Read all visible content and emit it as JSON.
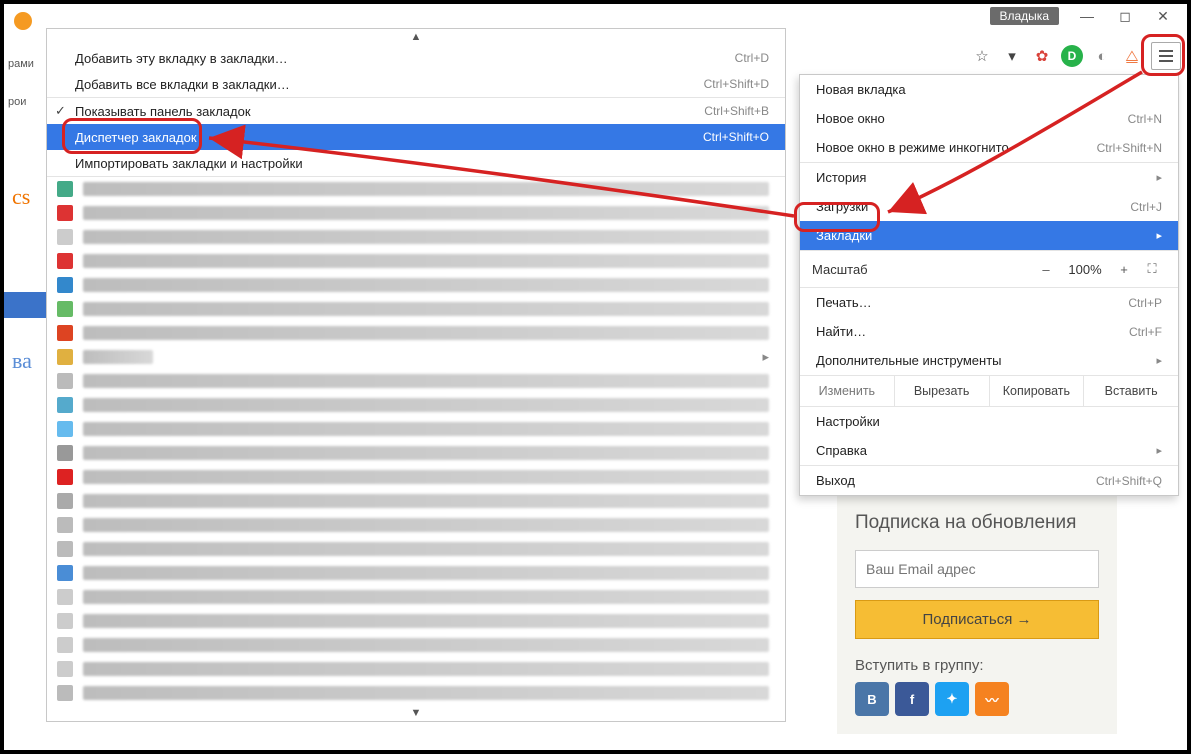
{
  "window": {
    "user_badge": "Владыка"
  },
  "bookmarks_submenu": {
    "add_tab": "Добавить эту вкладку в закладки…",
    "add_tab_sc": "Ctrl+D",
    "add_all": "Добавить все вкладки в закладки…",
    "add_all_sc": "Ctrl+Shift+D",
    "show_bar": "Показывать панель закладок",
    "show_bar_sc": "Ctrl+Shift+B",
    "manager": "Диспетчер закладок",
    "manager_sc": "Ctrl+Shift+O",
    "import": "Импортировать закладки и настройки"
  },
  "main_menu": {
    "new_tab": "Новая вкладка",
    "new_window": "Новое окно",
    "new_window_sc": "Ctrl+N",
    "incognito": "Новое окно в режиме инкогнито",
    "incognito_sc": "Ctrl+Shift+N",
    "history": "История",
    "downloads": "Загрузки",
    "downloads_sc": "Ctrl+J",
    "bookmarks": "Закладки",
    "zoom_label": "Масштаб",
    "zoom_value": "100%",
    "print": "Печать…",
    "print_sc": "Ctrl+P",
    "find": "Найти…",
    "find_sc": "Ctrl+F",
    "more_tools": "Дополнительные инструменты",
    "edit_label": "Изменить",
    "cut": "Вырезать",
    "copy": "Копировать",
    "paste": "Вставить",
    "settings": "Настройки",
    "help": "Справка",
    "exit": "Выход",
    "exit_sc": "Ctrl+Shift+Q"
  },
  "subscribe": {
    "title": "Подписка на обновления",
    "placeholder": "Ваш Email адрес",
    "button": "Подписаться →",
    "join": "Вступить в группу:"
  },
  "left": {
    "t1": "рами",
    "t2": "рои"
  }
}
